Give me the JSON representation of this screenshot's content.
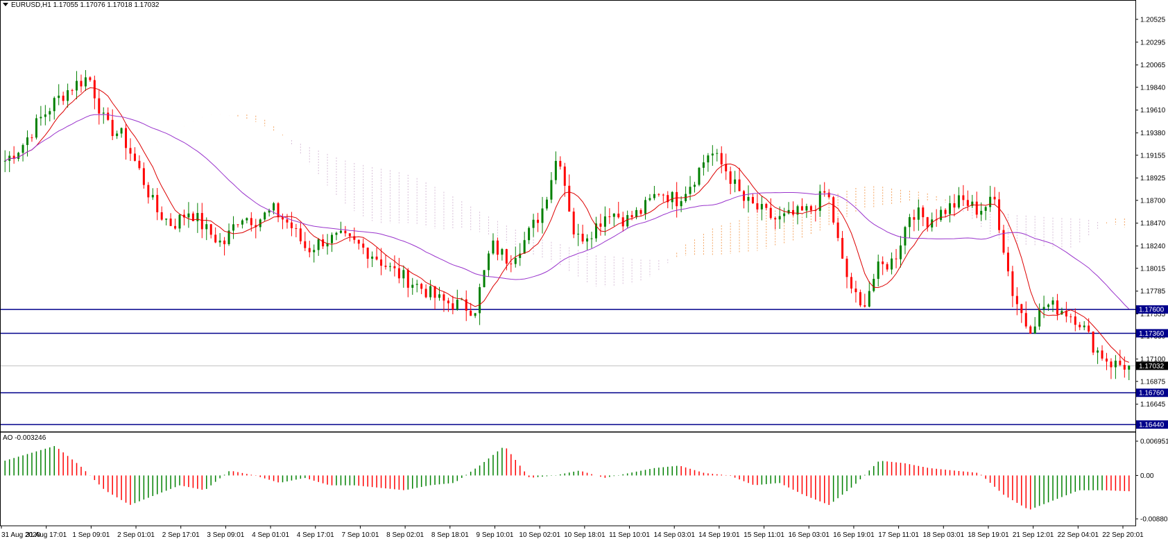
{
  "header": {
    "symbol_info": "EURUSD,H1  1.17055 1.17076 1.17018 1.17032"
  },
  "oscillator": {
    "label": "AO -0.003246"
  },
  "price_scale": {
    "ticks": [
      "1.20525",
      "1.20295",
      "1.20065",
      "1.19840",
      "1.19610",
      "1.19380",
      "1.19155",
      "1.18925",
      "1.18700",
      "1.18470",
      "1.18240",
      "1.18015",
      "1.17785",
      "1.17555",
      "1.17330",
      "1.17100",
      "1.16875",
      "1.16645"
    ],
    "current_price": "1.17032",
    "current_price_value": 1.17032
  },
  "ao_scale": {
    "ticks": [
      "0.006951",
      "0.00",
      "-0.008802"
    ]
  },
  "time_axis": {
    "labels": [
      "31 Aug 2020",
      "31 Aug 17:01",
      "1 Sep 09:01",
      "2 Sep 01:01",
      "2 Sep 17:01",
      "3 Sep 09:01",
      "4 Sep 01:01",
      "4 Sep 17:01",
      "7 Sep 10:01",
      "8 Sep 02:01",
      "8 Sep 18:01",
      "9 Sep 10:01",
      "10 Sep 02:01",
      "10 Sep 18:01",
      "11 Sep 10:01",
      "14 Sep 03:01",
      "14 Sep 19:01",
      "15 Sep 11:01",
      "16 Sep 03:01",
      "16 Sep 19:01",
      "17 Sep 11:01",
      "18 Sep 03:01",
      "18 Sep 19:01",
      "21 Sep 12:01",
      "22 Sep 04:01",
      "22 Sep 20:01"
    ]
  },
  "horizontal_levels": [
    {
      "label": "1.17600",
      "value": 1.176
    },
    {
      "label": "1.17360",
      "value": 1.1736
    },
    {
      "label": "1.16760",
      "value": 1.1676
    },
    {
      "label": "1.16440",
      "value": 1.1644
    }
  ],
  "colors": {
    "bull_candle": "#008000",
    "bear_candle": "#ff0000",
    "fast_ma": "#dd0000",
    "slow_ma": "#9933cc",
    "cloud_bull": "#f4a460",
    "cloud_bear": "#d8bfd8",
    "level_line": "#00008b",
    "current_line": "#c0c0c0"
  },
  "chart_data": {
    "type": "candlestick",
    "symbol": "EURUSD",
    "timeframe": "H1",
    "ylim": [
      1.1644,
      1.2065
    ],
    "anchor_prices": [
      1.191,
      1.1925,
      1.195,
      1.197,
      1.1985,
      1.1995,
      1.1945,
      1.1935,
      1.19,
      1.186,
      1.1845,
      1.186,
      1.184,
      1.1825,
      1.1855,
      1.185,
      1.186,
      1.1845,
      1.182,
      1.183,
      1.1832,
      1.1825,
      1.1815,
      1.18,
      1.179,
      1.178,
      1.1768,
      1.1765,
      1.176,
      1.1825,
      1.181,
      1.183,
      1.186,
      1.192,
      1.183,
      1.184,
      1.186,
      1.185,
      1.186,
      1.188,
      1.187,
      1.189,
      1.192,
      1.19,
      1.187,
      1.186,
      1.185,
      1.1855,
      1.186,
      1.188,
      1.18,
      1.176,
      1.18,
      1.181,
      1.186,
      1.185,
      1.186,
      1.187,
      1.186,
      1.187,
      1.178,
      1.174,
      1.1765,
      1.176,
      1.175,
      1.172,
      1.1705,
      1.17032
    ],
    "ao_anchor_values": [
      0.003,
      0.0045,
      0.006,
      0.002,
      -0.003,
      -0.006,
      -0.004,
      -0.002,
      -0.003,
      0.001,
      0.0,
      -0.0015,
      -0.0005,
      -0.002,
      -0.002,
      -0.0025,
      -0.003,
      -0.002,
      -0.0015,
      0.002,
      0.006,
      -0.0005,
      0.0,
      0.001,
      -0.0005,
      0.0005,
      0.0015,
      0.002,
      0.0005,
      0.0,
      -0.002,
      -0.0015,
      -0.004,
      -0.006,
      -0.002,
      0.003,
      0.0025,
      0.0015,
      0.001,
      0.0005,
      -0.004,
      -0.007,
      -0.005,
      -0.003,
      -0.003,
      -0.0032
    ]
  }
}
